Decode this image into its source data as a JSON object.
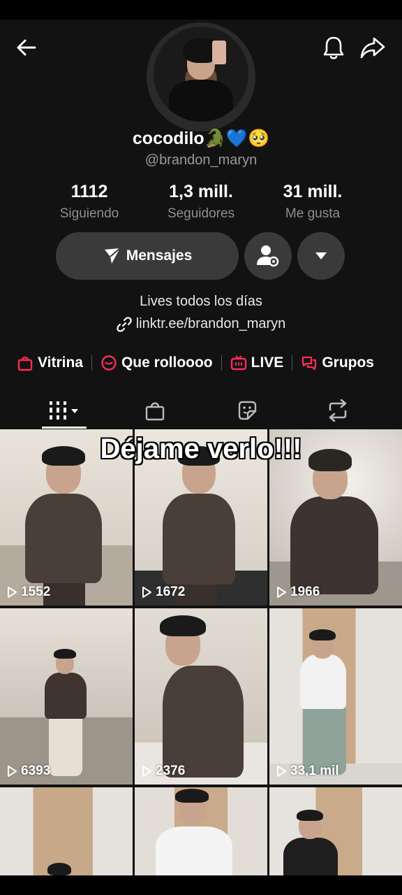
{
  "profile": {
    "display_name": "cocodilo🐊💙🥺",
    "username": "@brandon_maryn",
    "bio": "Lives todos los días",
    "link": "linktr.ee/brandon_maryn"
  },
  "stats": [
    {
      "value": "1112",
      "label": "Siguiendo"
    },
    {
      "value": "1,3 mill.",
      "label": "Seguidores"
    },
    {
      "value": "31 mill.",
      "label": "Me gusta"
    }
  ],
  "actions": {
    "message_label": "Mensajes"
  },
  "chips": [
    {
      "label": "Vitrina",
      "icon": "shopping-bag-icon"
    },
    {
      "label": "Que rolloooo",
      "icon": "chat-bubble-icon"
    },
    {
      "label": "LIVE",
      "icon": "live-tv-icon"
    },
    {
      "label": "Grupos",
      "icon": "group-chat-icon"
    }
  ],
  "tabs": [
    {
      "name": "videos",
      "icon": "grid-icon",
      "active": true
    },
    {
      "name": "shop",
      "icon": "shopping-bag-icon"
    },
    {
      "name": "favorites",
      "icon": "sticker-icon"
    },
    {
      "name": "reposts",
      "icon": "repost-icon"
    }
  ],
  "overlay_caption": "Déjame verlo!!!",
  "videos": [
    {
      "views": "1552"
    },
    {
      "views": "1672"
    },
    {
      "views": "1966"
    },
    {
      "views": "6393"
    },
    {
      "views": "2376"
    },
    {
      "views": "33,1 mil"
    },
    {
      "views": ""
    },
    {
      "views": ""
    },
    {
      "views": ""
    }
  ],
  "colors": {
    "background": "#121212",
    "button": "#3a3a3a",
    "accent": "#fe2c55",
    "muted_text": "#8e8e8e"
  }
}
